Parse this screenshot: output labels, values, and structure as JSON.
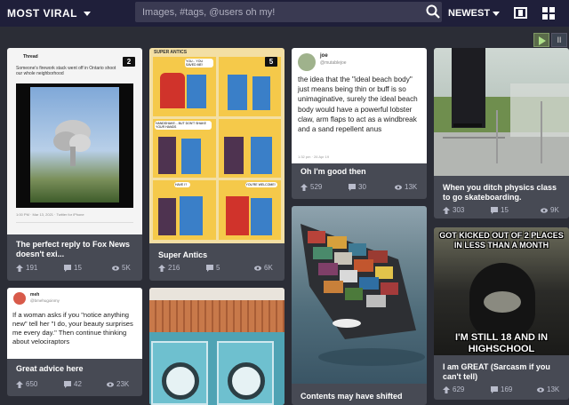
{
  "header": {
    "sort_left_label": "MOST VIRAL",
    "search_placeholder": "Images, #tags, @users oh my!",
    "sort_right_label": "NEWEST"
  },
  "posts": [
    {
      "title": "The perfect reply to Fox News doesn't exi...",
      "badge": "2",
      "embed": {
        "header": "Thread",
        "text": "Someone's firework stack went off in Ontario shoot our whole neighborhood",
        "footer": "1:00 PM · Mar 13, 2021 · Twitter for iPhone"
      },
      "upvotes": "191",
      "comments": "15",
      "views": "5K"
    },
    {
      "title": "Great advice here",
      "embed": {
        "username": "meh",
        "handle": "@bmehugoinmy",
        "text": "If a woman asks if you \"notice anything new\" tell her \"I do, your beauty surprises me every day.\" Then continue thinking about velociraptors"
      },
      "upvotes": "650",
      "comments": "42",
      "views": "23K"
    },
    {
      "title": "Super Antics",
      "badge": "5",
      "embed": {
        "comic_title": "SUPER ANTICS",
        "panel_texts": [
          "YOU... YOU SAVED ME!",
          "HANDSHAKE... BUT DON'T SHAKE YOUR HANDS",
          "HAVE I?",
          "YOU'RE WELCOME!"
        ]
      },
      "upvotes": "216",
      "comments": "5",
      "views": "6K"
    },
    {
      "title": "",
      "upvotes": "",
      "comments": "",
      "views": ""
    },
    {
      "title": "Oh I'm good then",
      "embed": {
        "username": "joe",
        "handle": "@mutablejoe",
        "text": "the idea that the \"ideal beach body\" just means being thin or buff is so unimaginative, surely the ideal beach body would have a powerful lobster claw, arm flaps to act as a windbreak and a sand repellent anus",
        "footer": "1:32 pm · 26 Apr 19"
      },
      "upvotes": "529",
      "comments": "30",
      "views": "13K"
    },
    {
      "title": "Contents may have shifted",
      "upvotes": "",
      "comments": "",
      "views": ""
    },
    {
      "title": "When you ditch physics class to go skateboarding.",
      "upvotes": "303",
      "comments": "15",
      "views": "9K"
    },
    {
      "title": "I am GREAT (Sarcasm if you can't tell)",
      "embed": {
        "meme_top": "GOT KICKED OUT OF 2 PLACES IN LESS THAN A MONTH",
        "meme_bottom": "I'M STILL 18 AND IN HIGHSCHOOL"
      },
      "upvotes": "629",
      "comments": "169",
      "views": "13K"
    }
  ],
  "colors": {
    "topbar": "#1f1f3a",
    "page_bg": "#2b2d36",
    "card_bg": "#474a54",
    "stat_text": "#b9bccb"
  },
  "icons": [
    "caret-down-icon",
    "search-icon",
    "single-view-icon",
    "grid-view-icon",
    "play-icon",
    "pause-icon",
    "upvote-arrow-icon",
    "comment-icon",
    "eye-icon"
  ]
}
